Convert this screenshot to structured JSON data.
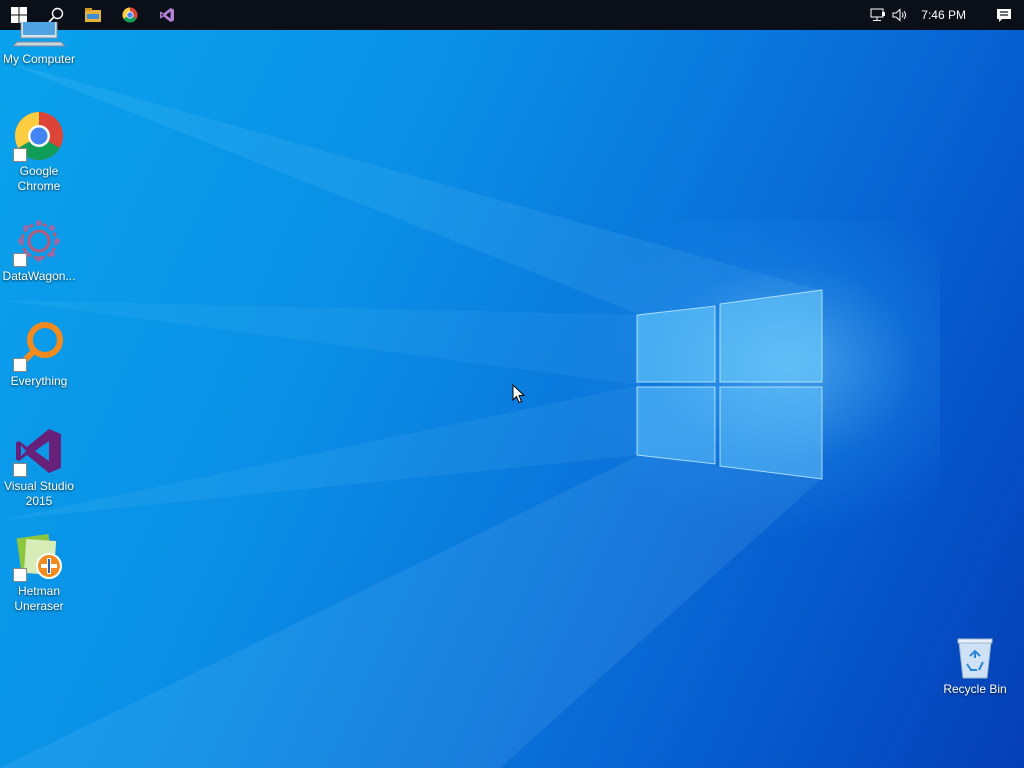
{
  "taskbar": {
    "buttons": [
      {
        "name": "start",
        "icon": "windows-logo-icon"
      },
      {
        "name": "search",
        "icon": "search-icon"
      },
      {
        "name": "file-explorer",
        "icon": "folder-icon"
      },
      {
        "name": "chrome",
        "icon": "chrome-icon"
      },
      {
        "name": "visual-studio",
        "icon": "visual-studio-icon"
      }
    ],
    "tray": {
      "icons": [
        "network-icon",
        "volume-icon"
      ],
      "clock": "7:46 PM",
      "notification_icon": "action-center-icon"
    }
  },
  "desktop": {
    "icons": [
      {
        "label": "My Computer",
        "icon": "computer-icon"
      },
      {
        "label": "Google\nChrome",
        "icon": "chrome-icon"
      },
      {
        "label": "DataWagon...",
        "icon": "gear-cluster-icon"
      },
      {
        "label": "Everything",
        "icon": "magnifier-icon"
      },
      {
        "label": "Visual Studio\n2015",
        "icon": "visual-studio-icon"
      },
      {
        "label": "Hetman\nUneraser",
        "icon": "uneraser-icon"
      },
      {
        "label": "Recycle Bin",
        "icon": "recycle-bin-icon"
      }
    ]
  },
  "colors": {
    "taskbar": "#0b0f18",
    "wallpaper_light": "#0aa3ec",
    "wallpaper_dark": "#063fb5",
    "vs_purple": "#68217a",
    "everything_orange": "#f28a1e"
  }
}
